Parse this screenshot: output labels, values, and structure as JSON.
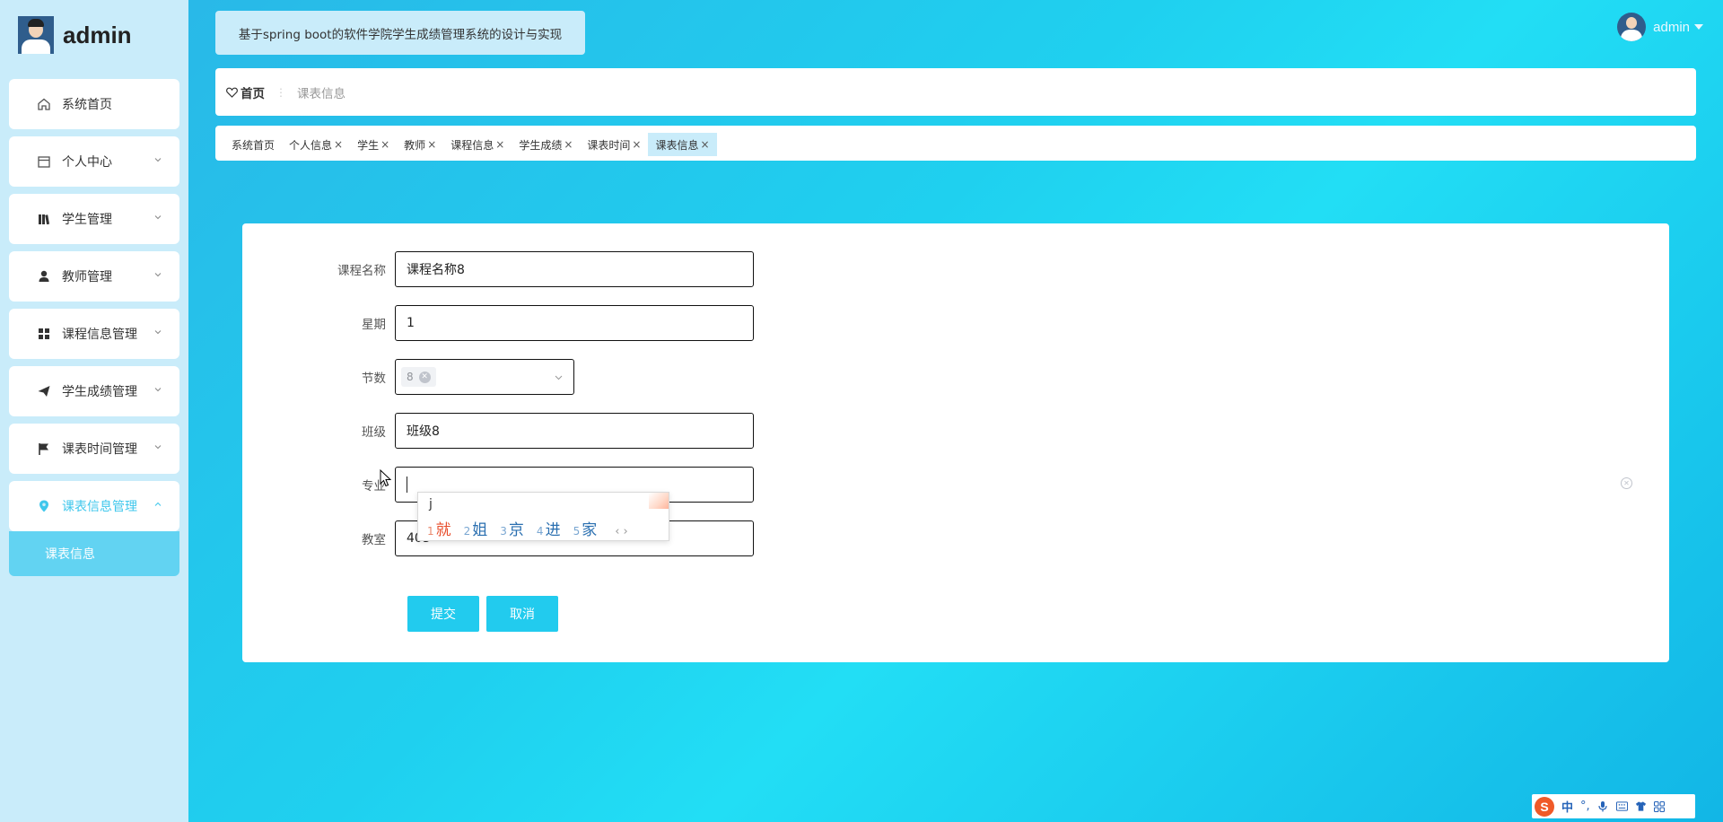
{
  "brand": {
    "name": "admin"
  },
  "sidebar": {
    "items": [
      {
        "label": "系统首页",
        "icon": "home-icon"
      },
      {
        "label": "个人中心",
        "icon": "calendar-icon"
      },
      {
        "label": "学生管理",
        "icon": "book-icon"
      },
      {
        "label": "教师管理",
        "icon": "user-icon"
      },
      {
        "label": "课程信息管理",
        "icon": "grid-icon"
      },
      {
        "label": "学生成绩管理",
        "icon": "send-icon"
      },
      {
        "label": "课表时间管理",
        "icon": "flag-icon"
      },
      {
        "label": "课表信息管理",
        "icon": "location-pin-icon"
      }
    ],
    "submenu_active": "课表信息"
  },
  "header": {
    "system_title": "基于spring boot的软件学院学生成绩管理系统的设计与实现",
    "user_name": "admin"
  },
  "breadcrumb": {
    "home": "首页",
    "separator": "⋮",
    "current": "课表信息"
  },
  "tabs": [
    {
      "label": "系统首页",
      "closable": false
    },
    {
      "label": "个人信息",
      "closable": true
    },
    {
      "label": "学生",
      "closable": true
    },
    {
      "label": "教师",
      "closable": true
    },
    {
      "label": "课程信息",
      "closable": true
    },
    {
      "label": "学生成绩",
      "closable": true
    },
    {
      "label": "课表时间",
      "closable": true
    },
    {
      "label": "课表信息",
      "closable": true,
      "active": true
    }
  ],
  "tab_close_symbol": "×",
  "form": {
    "course_name": {
      "label": "课程名称",
      "value": "课程名称8"
    },
    "weekday": {
      "label": "星期",
      "value": "1"
    },
    "period": {
      "label": "节数",
      "selected": "8"
    },
    "class": {
      "label": "班级",
      "value": "班级8"
    },
    "major": {
      "label": "专业",
      "value": ""
    },
    "classroom": {
      "label": "教室",
      "value": "403"
    },
    "submit_label": "提交",
    "cancel_label": "取消"
  },
  "ime": {
    "composition": "j",
    "candidates": [
      {
        "n": "1",
        "text": "就"
      },
      {
        "n": "2",
        "text": "姐"
      },
      {
        "n": "3",
        "text": "京"
      },
      {
        "n": "4",
        "text": "进"
      },
      {
        "n": "5",
        "text": "家"
      }
    ],
    "nav": "‹  ›"
  },
  "ime_status": {
    "logo": "S",
    "mode": "中",
    "punct": "°,"
  },
  "colors": {
    "accent": "#22cbee",
    "sidebar_bg": "#c9ecfa",
    "active_sub": "#62d3f2"
  }
}
